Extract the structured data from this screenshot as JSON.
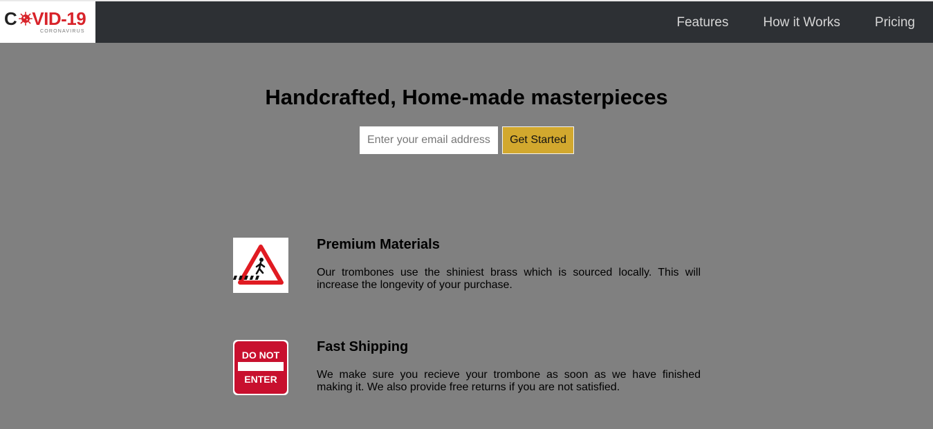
{
  "header": {
    "logo": {
      "text_before": "C",
      "text_after": "VID-19",
      "subtitle": "CORONAVIRUS",
      "icon": "virus-icon"
    },
    "nav": [
      {
        "label": "Features"
      },
      {
        "label": "How it Works"
      },
      {
        "label": "Pricing"
      }
    ]
  },
  "hero": {
    "title": "Handcrafted, Home-made masterpieces",
    "email_placeholder": "Enter your email address",
    "email_value": "",
    "button_label": "Get Started"
  },
  "features": [
    {
      "icon": "pedestrian-crossing-sign-icon",
      "title": "Premium Materials",
      "description": "Our trombones use the shiniest brass which is sourced locally. This will increase the longevity of your purchase."
    },
    {
      "icon": "do-not-enter-sign-icon",
      "title": "Fast Shipping",
      "description": "We make sure you recieve your trombone as soon as we have finished making it. We also provide free returns if you are not satisfied.",
      "sign_text_top": "DO NOT",
      "sign_text_bottom": "ENTER"
    }
  ],
  "colors": {
    "page_background": "#808080",
    "header_background": "#2d3034",
    "nav_text": "#d6d6d6",
    "button_accent": "#d2a82e",
    "logo_red": "#d8232a"
  }
}
